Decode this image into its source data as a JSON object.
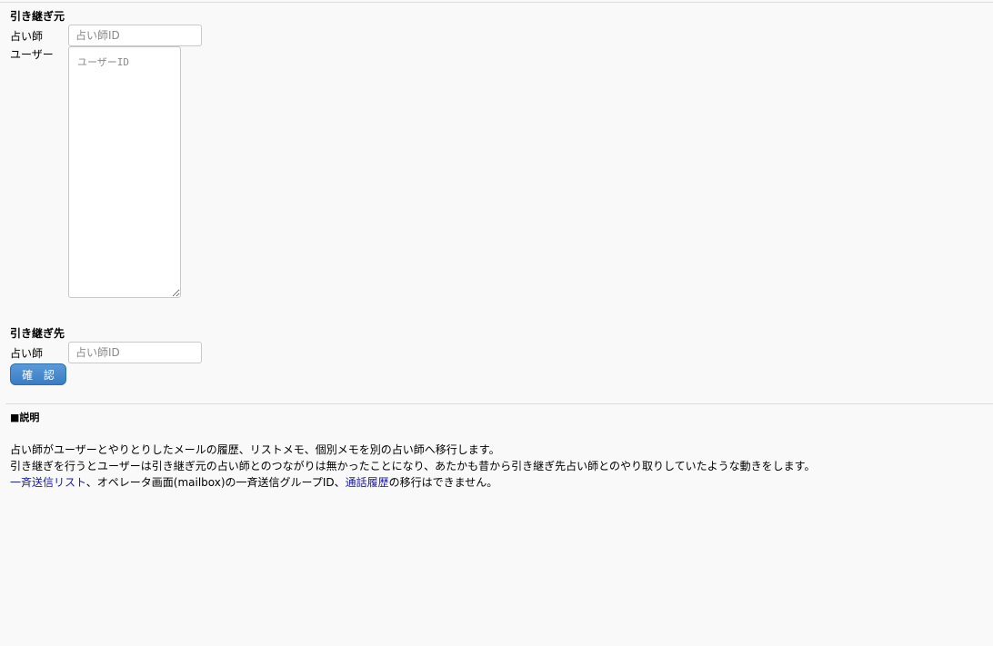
{
  "source": {
    "heading": "引き継ぎ元",
    "fortune_teller_label": "占い師",
    "fortune_teller_placeholder": "占い師ID",
    "fortune_teller_value": "",
    "user_label": "ユーザー",
    "user_placeholder": "ユーザーID",
    "user_value": ""
  },
  "destination": {
    "heading": "引き継ぎ先",
    "fortune_teller_label": "占い師",
    "fortune_teller_placeholder": "占い師ID",
    "fortune_teller_value": ""
  },
  "actions": {
    "confirm_label": "確 認"
  },
  "description": {
    "heading": "■説明",
    "line1": "占い師がユーザーとやりとりしたメールの履歴、リストメモ、個別メモを別の占い師へ移行します。",
    "line2": "引き継ぎを行うとユーザーは引き継ぎ元の占い師とのつながりは無かったことになり、あたかも昔から引き継ぎ先占い師とのやり取りしていたような動きをします。",
    "line3_link1": "一斉送信リスト",
    "line3_text1": "、オペレータ画面(mailbox)の一斉送信グループID、",
    "line3_link2": "通話履歴",
    "line3_text2": "の移行はできません。"
  },
  "colors": {
    "link": "#1a1aa8",
    "button": "#3a7cc4",
    "background": "#f9f9f9"
  }
}
